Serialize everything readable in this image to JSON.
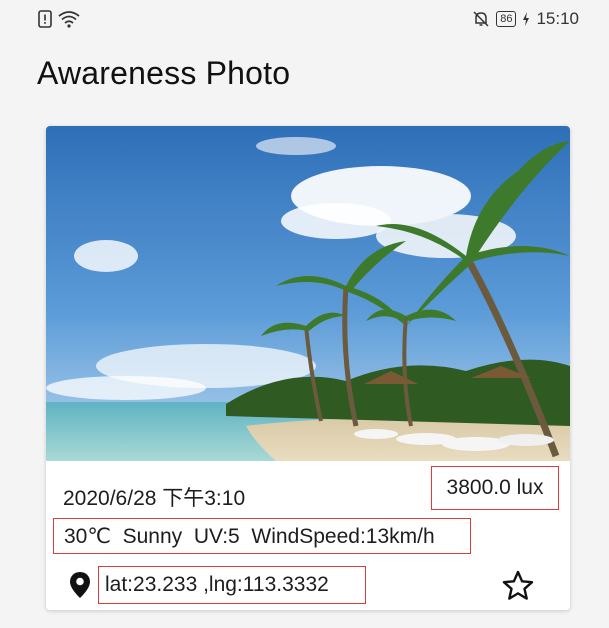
{
  "status_bar": {
    "battery": "86",
    "time": "15:10"
  },
  "app": {
    "title": "Awareness Photo"
  },
  "card": {
    "datetime": "2020/6/28 下午3:10",
    "light": "3800.0 lux",
    "weather": "30℃  Sunny  UV:5  WindSpeed:13km/h",
    "location": "lat:23.233 ,lng:113.3332",
    "photo_subject": "tropical beach with palm trees",
    "favorite_icon": "star-outline-icon",
    "location_icon": "map-pin-icon"
  },
  "colors": {
    "highlight_border": "#e03a3a",
    "background": "#f4f4f4",
    "card": "#ffffff"
  }
}
